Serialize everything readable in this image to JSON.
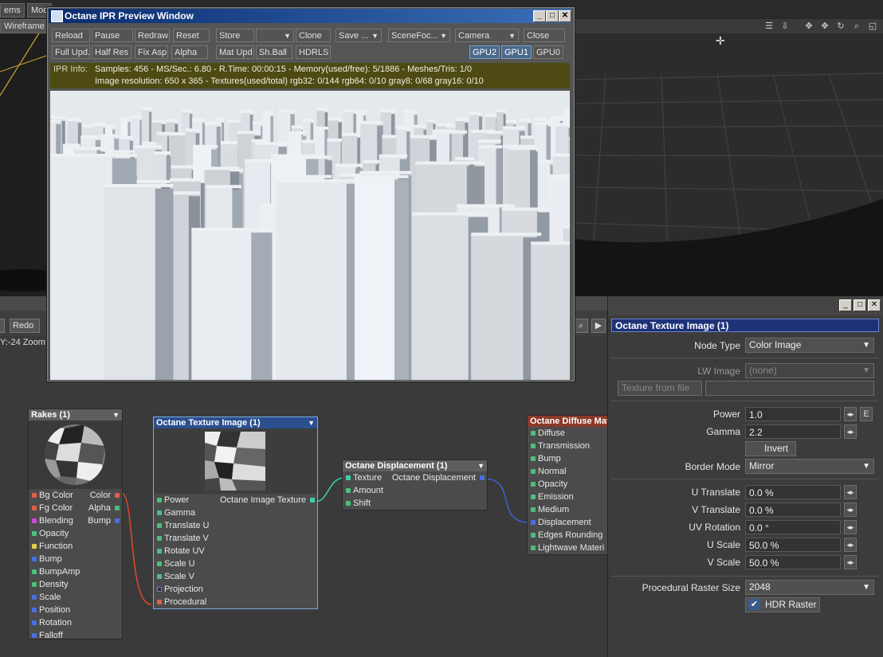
{
  "viewport": {
    "tabs": [
      "ems",
      "Mod"
    ],
    "view_mode": "Wireframe",
    "undo_label": "Redo",
    "status": "Y:-24 Zoom:"
  },
  "ipr": {
    "title": "Octane IPR Preview Window",
    "row1": [
      "Reload",
      "Pause",
      "Redraw",
      "Reset",
      "Store",
      "",
      "Clone",
      "Save ...",
      "SceneFoc...",
      "Camera",
      "Close"
    ],
    "row2": [
      "Full Upd.",
      "Half Res",
      "Fix Asp.",
      "Alpha",
      "Mat Upd",
      "Sh.Ball",
      "HDRLS"
    ],
    "gpus": [
      "GPU2",
      "GPU1",
      "GPU0"
    ],
    "info_label": "IPR Info:",
    "info_line1": "Samples: 456  -  MS/Sec.: 6.80  -  R.Time: 00:00:15 - Memory(used/free): 5/1886  -  Meshes/Tris: 1/0",
    "info_line2": "Image resolution: 650 x 365 - Textures(used/total) rgb32: 0/144  rgb64: 0/10  gray8: 0/68  gray16: 0/10"
  },
  "nodes": {
    "rakes": {
      "title": "Rakes (1)",
      "inputs": [
        "Bg Color",
        "Fg Color",
        "Blending",
        "Opacity",
        "Function",
        "Bump",
        "BumpAmp",
        "Density",
        "Scale",
        "Position",
        "Rotation",
        "Falloff"
      ],
      "outputs": [
        "Color",
        "Alpha",
        "Bump"
      ]
    },
    "texture": {
      "title": "Octane Texture Image (1)",
      "inputs": [
        "Power",
        "Gamma",
        "Translate U",
        "Translate V",
        "Rotate UV",
        "Scale U",
        "Scale V",
        "Projection",
        "Procedural"
      ],
      "output": "Octane Image Texture"
    },
    "displacement": {
      "title": "Octane Displacement (1)",
      "inputs": [
        "Texture",
        "Amount",
        "Shift"
      ],
      "output": "Octane Displacement"
    },
    "diffuse": {
      "title": "Octane Diffuse Mate",
      "inputs": [
        "Diffuse",
        "Transmission",
        "Bump",
        "Normal",
        "Opacity",
        "Emission",
        "Medium",
        "Displacement",
        "Edges Rounding",
        "Lightwave Materi"
      ]
    }
  },
  "panel": {
    "title": "Octane Texture Image (1)",
    "node_type_label": "Node Type",
    "node_type_value": "Color Image",
    "lw_image_label": "LW Image",
    "lw_image_value": "(none)",
    "texture_from_file": "Texture from file",
    "power_label": "Power",
    "power_value": "1.0",
    "power_e": "E",
    "gamma_label": "Gamma",
    "gamma_value": "2.2",
    "invert_label": "Invert",
    "border_mode_label": "Border Mode",
    "border_mode_value": "Mirror",
    "u_translate_label": "U Translate",
    "u_translate_value": "0.0 %",
    "v_translate_label": "V Translate",
    "v_translate_value": "0.0 %",
    "uv_rotation_label": "UV Rotation",
    "uv_rotation_value": "0.0 °",
    "u_scale_label": "U Scale",
    "u_scale_value": "50.0 %",
    "v_scale_label": "V Scale",
    "v_scale_value": "50.0 %",
    "raster_size_label": "Procedural Raster Size",
    "raster_size_value": "2048",
    "hdr_raster_label": "HDR Raster",
    "hdr_raster_checked": true
  }
}
